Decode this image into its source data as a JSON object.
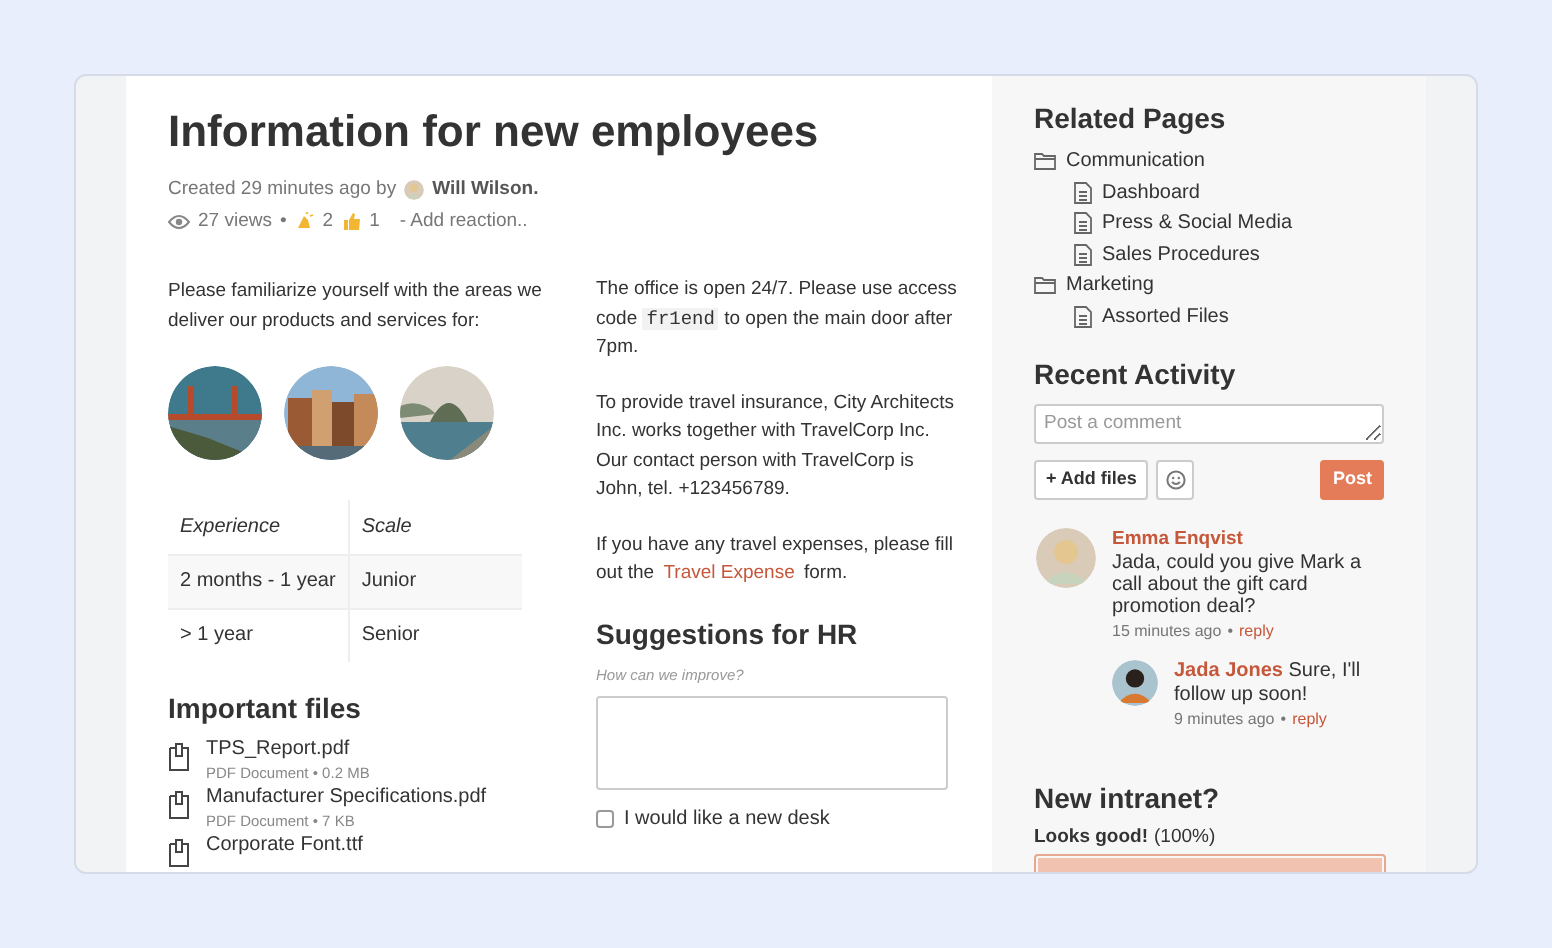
{
  "page": {
    "title": "Information for new employees",
    "created": "Created 29 minutes ago by",
    "author": "Will Wilson.",
    "views": "27 views",
    "separator": "•",
    "reactions": [
      {
        "kind": "clap",
        "count": "2"
      },
      {
        "kind": "thumbs",
        "count": "1"
      }
    ],
    "add_reaction": "- Add reaction.."
  },
  "left_column": {
    "intro": "Please familiarize yourself with the areas we deliver our products and services for:",
    "table": {
      "columns": [
        "Experience",
        "Scale"
      ],
      "rows": [
        [
          "2 months - 1 year",
          "Junior"
        ],
        [
          "> 1 year",
          "Senior"
        ]
      ]
    },
    "files_heading": "Important files",
    "files": [
      {
        "name": "TPS_Report.pdf",
        "meta": "PDF Document • 0.2 MB"
      },
      {
        "name": "Manufacturer Specifications.pdf",
        "meta": "PDF Document • 7 KB"
      },
      {
        "name": "Corporate Font.ttf"
      }
    ]
  },
  "right_column": {
    "paragraphs": [
      {
        "parts": [
          {
            "kind": "text",
            "text": "The office is open 24/7. Please use access code "
          },
          {
            "kind": "code",
            "text": "fr1end"
          },
          {
            "kind": "text",
            "text": " to open the main door after 7pm."
          }
        ]
      },
      {
        "parts": [
          {
            "kind": "text",
            "text": "To provide travel insurance, City Architects Inc. works together with TravelCorp Inc. Our contact person with TravelCorp is John, tel. +123456789."
          }
        ]
      },
      {
        "parts": [
          {
            "kind": "text",
            "text": "If you have any travel expenses, please fill out the "
          },
          {
            "kind": "link",
            "text": "Travel Expense"
          },
          {
            "kind": "text",
            "text": " form."
          }
        ]
      }
    ],
    "suggestions": {
      "heading": "Suggestions for HR",
      "label": "How can we improve?",
      "checkbox": {
        "label": "I would like a new desk",
        "checked": false
      }
    }
  },
  "sidebar": {
    "related_heading": "Related Pages",
    "tree": [
      {
        "label": "Communication",
        "kind": "folder",
        "children": [
          {
            "label": "Dashboard",
            "kind": "page"
          },
          {
            "label": "Press & Social Media",
            "kind": "page"
          },
          {
            "label": "Sales Procedures",
            "kind": "page"
          }
        ]
      },
      {
        "label": "Marketing",
        "kind": "folder",
        "children": [
          {
            "label": "Assorted Files",
            "kind": "page"
          }
        ]
      }
    ],
    "activity_heading": "Recent Activity",
    "comment_placeholder": "Post a comment",
    "add_files": "+ Add files",
    "post": "Post",
    "comments": [
      {
        "author": "Emma Enqvist",
        "text": "Jada, could you give Mark a call about the gift card promotion deal?",
        "time": "15 minutes ago",
        "reply": "reply",
        "replies": [
          {
            "author": "Jada Jones",
            "text": "Sure, I'll follow up soon!",
            "time": "9 minutes ago",
            "reply": "reply"
          }
        ]
      }
    ],
    "poll": {
      "heading": "New intranet?",
      "options": [
        {
          "label": "Looks good!",
          "percent": "(100%)",
          "level": 1
        }
      ]
    }
  }
}
